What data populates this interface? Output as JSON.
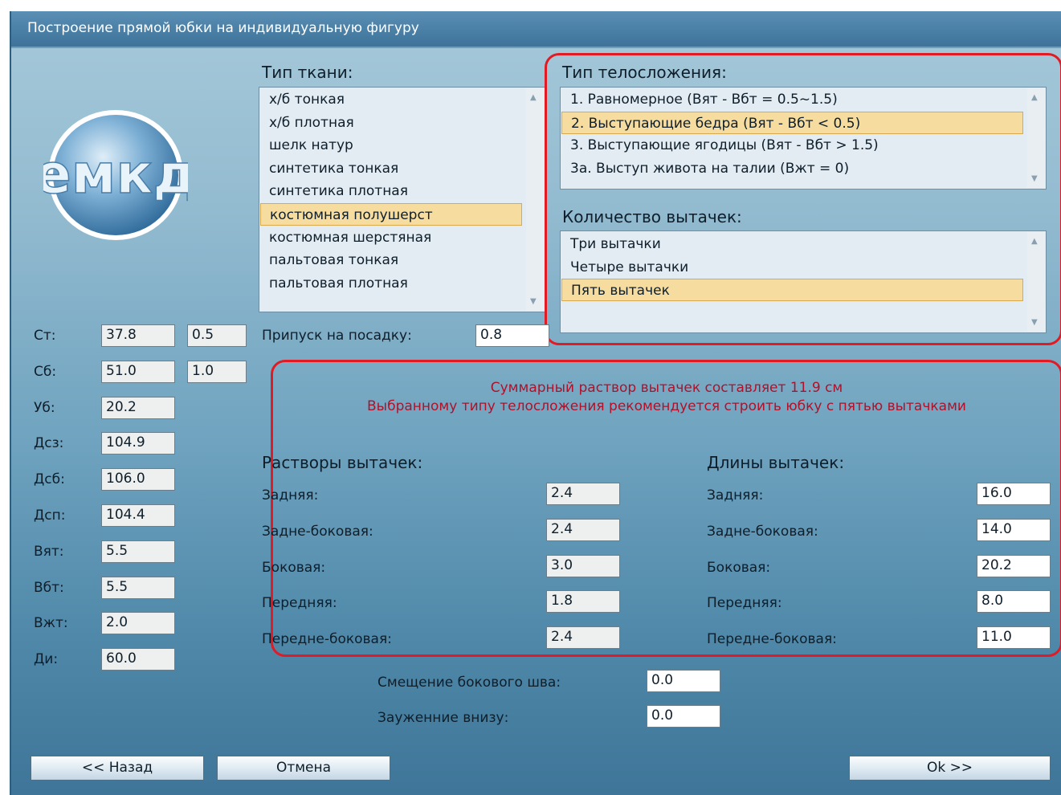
{
  "window": {
    "title": "Построение прямой юбки на индивидуальную фигуру"
  },
  "logo": {
    "text": "емкд"
  },
  "fabric": {
    "header": "Тип ткани:",
    "items": [
      "х/б тонкая",
      "х/б плотная",
      "шелк натур",
      "синтетика тонкая",
      "синтетика плотная",
      "костюмная полушерст",
      "костюмная шерстяная",
      "пальтовая тонкая",
      "пальтовая плотная"
    ],
    "selected_index": 5
  },
  "body_type": {
    "header": "Тип телосложения:",
    "items": [
      "1. Равномерное (Вят - Вбт = 0.5~1.5)",
      "2. Выступающие бедра (Вят - Вбт < 0.5)",
      "3. Выступающие ягодицы (Вят - Вбт > 1.5)",
      "3а. Выступ живота на талии (Вжт = 0)"
    ],
    "selected_index": 1
  },
  "dart_count": {
    "header": "Количество вытачек:",
    "items": [
      "Три вытачки",
      "Четыре вытачки",
      "Пять вытачек"
    ],
    "selected_index": 2
  },
  "measurements": [
    {
      "label": "Ст:",
      "value": "37.8",
      "extra": "0.5"
    },
    {
      "label": "Сб:",
      "value": "51.0",
      "extra": "1.0"
    },
    {
      "label": "Уб:",
      "value": "20.2"
    },
    {
      "label": "Дсз:",
      "value": "104.9"
    },
    {
      "label": "Дсб:",
      "value": "106.0"
    },
    {
      "label": "Дсп:",
      "value": "104.4"
    },
    {
      "label": "Вят:",
      "value": "5.5"
    },
    {
      "label": "Вбт:",
      "value": "5.5"
    },
    {
      "label": "Вжт:",
      "value": "2.0"
    },
    {
      "label": "Ди:",
      "value": "60.0"
    }
  ],
  "fit_allowance": {
    "label": "Припуск на посадку:",
    "value": "0.8"
  },
  "summary": {
    "line1": "Суммарный раствор вытачек составляет 11.9 см",
    "line2": "Выбранному типу телосложения рекомендуется строить юбку с пятью вытачками"
  },
  "dart_widths": {
    "header": "Растворы вытачек:",
    "rows": [
      {
        "label": "Задняя:",
        "value": "2.4"
      },
      {
        "label": "Задне-боковая:",
        "value": "2.4"
      },
      {
        "label": "Боковая:",
        "value": "3.0"
      },
      {
        "label": "Передняя:",
        "value": "1.8"
      },
      {
        "label": "Передне-боковая:",
        "value": "2.4"
      }
    ]
  },
  "dart_lengths": {
    "header": "Длины вытачек:",
    "rows": [
      {
        "label": "Задняя:",
        "value": "16.0"
      },
      {
        "label": "Задне-боковая:",
        "value": "14.0"
      },
      {
        "label": "Боковая:",
        "value": "20.2"
      },
      {
        "label": "Передняя:",
        "value": "8.0"
      },
      {
        "label": "Передне-боковая:",
        "value": "11.0"
      }
    ]
  },
  "side_seam_shift": {
    "label": "Смещение бокового шва:",
    "value": "0.0"
  },
  "hem_narrowing": {
    "label": "Зауженние внизу:",
    "value": "0.0"
  },
  "buttons": {
    "back": "<< Назад",
    "cancel": "Отмена",
    "ok": "Ok >>"
  }
}
